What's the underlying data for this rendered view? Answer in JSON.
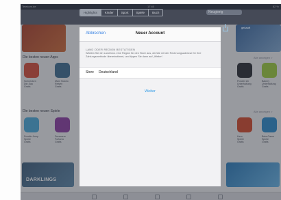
{
  "status_bar": {
    "left": "Telekom.de",
    "time": "17:40",
    "right": "82 %"
  },
  "nav": {
    "segments": [
      "Highlights",
      "Kinder",
      "Sport",
      "Spiele",
      "Buch"
    ],
    "search_placeholder": "Neugierig",
    "heading_right": "gekauft"
  },
  "background": {
    "row1_title": "Die besten neuen Apps",
    "row1_more": "Alle anzeigen >",
    "row1_tiles": [
      {
        "caption": "Schnecken\nDie-Sau\nGratis",
        "color": "#d04f3b"
      },
      {
        "caption": "Mare Nostro\nReisen\nGratis",
        "color": "#3e6d8f"
      },
      {
        "caption": "Ponder ich\nUnterhaltung\nGratis",
        "color": "#2c2f36"
      },
      {
        "caption": "Bakery\nUnterhaltung\nGratis",
        "color": "#9ac93f"
      }
    ],
    "row2_title": "Die besten neuen Spiele",
    "row2_more": "Alle anzeigen >",
    "row2_tiles": [
      {
        "caption": "Doodle Jump\nSpiele\nGratis",
        "color": "#4aa8d6"
      },
      {
        "caption": "Dreamers\nFortunio\nGratis",
        "color": "#8b3fa0"
      },
      {
        "caption": "Hero\nSpiele\nGratis",
        "color": "#cf4a2e"
      },
      {
        "caption": "Beta Game\nSpiele\nGratis",
        "color": "#2d8bc8"
      }
    ],
    "banner_text": "DARKLINGS"
  },
  "modal": {
    "cancel_label": "Abbrechen",
    "title": "Neuer Account",
    "section_title": "LAND ODER REGION BESTÄTIGEN",
    "section_description": "Wählen Sie ein Land bzw. eine Region für den Store aus, der/die mit der Rechnungsadresse für Ihre Zahlungsmethode übereinstimmt, und tippen Sie dann auf „Weiter“.",
    "store_label": "Store",
    "store_value": "Deutschland",
    "next_label": "Weiter"
  },
  "colors": {
    "accent": "#2f7de1",
    "link": "#2f9be6"
  }
}
